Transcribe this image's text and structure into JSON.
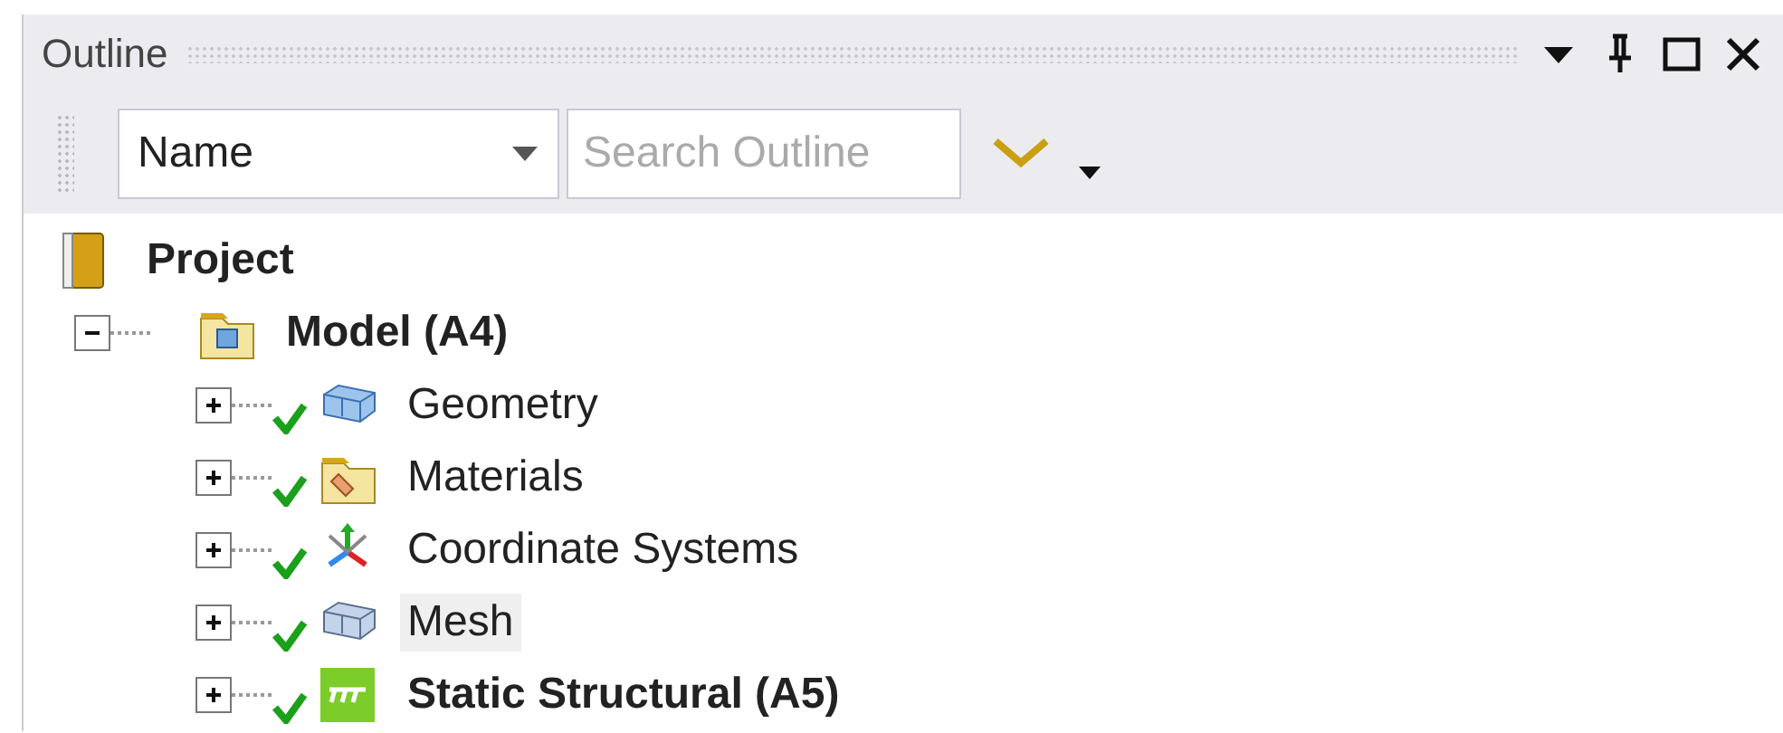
{
  "panel": {
    "title": "Outline"
  },
  "toolbar": {
    "sort_field": {
      "value": "Name"
    },
    "search": {
      "placeholder": "Search Outline"
    }
  },
  "tree": [
    {
      "label": "Project",
      "kind": "project",
      "bold": true,
      "selected": false,
      "checked": false,
      "children": [
        {
          "label": "Model (A4)",
          "kind": "model",
          "bold": true,
          "selected": false,
          "expanded": true,
          "checked": false,
          "children": [
            {
              "label": "Geometry",
              "kind": "geometry",
              "bold": false,
              "selected": false,
              "expanded": false,
              "checked": true
            },
            {
              "label": "Materials",
              "kind": "materials",
              "bold": false,
              "selected": false,
              "expanded": false,
              "checked": true
            },
            {
              "label": "Coordinate Systems",
              "kind": "coordinates",
              "bold": false,
              "selected": false,
              "expanded": false,
              "checked": true
            },
            {
              "label": "Mesh",
              "kind": "mesh",
              "bold": false,
              "selected": true,
              "expanded": false,
              "checked": true
            },
            {
              "label": "Static Structural (A5)",
              "kind": "analysis",
              "bold": true,
              "selected": false,
              "expanded": false,
              "checked": true
            }
          ]
        }
      ]
    }
  ]
}
